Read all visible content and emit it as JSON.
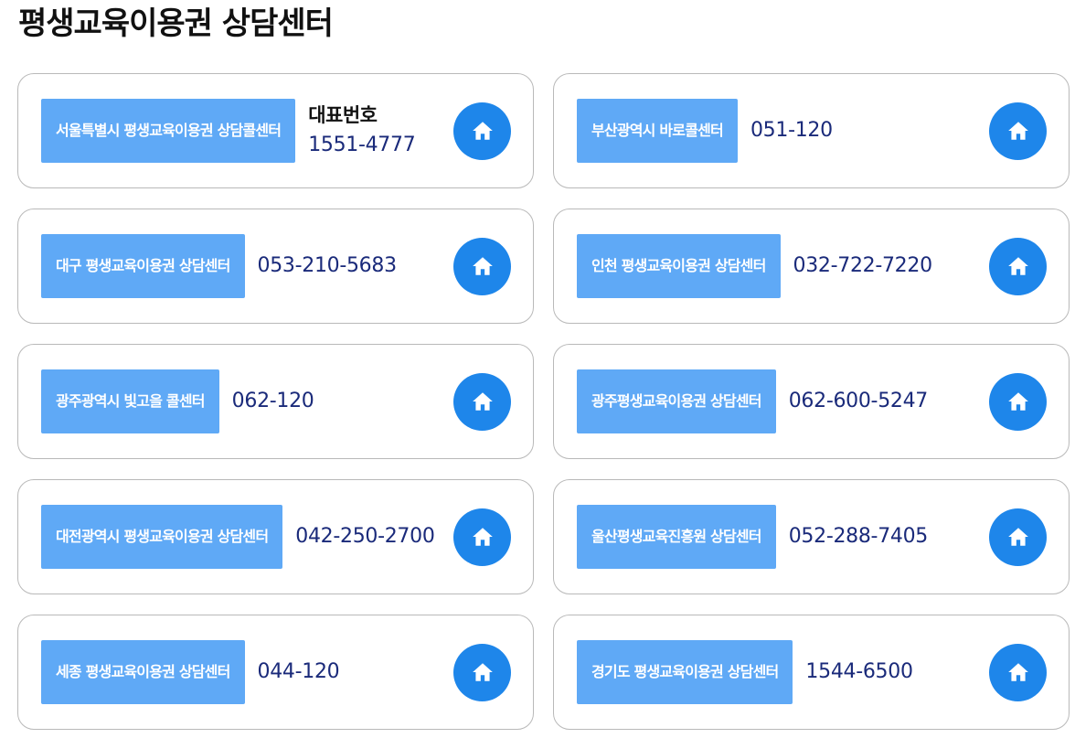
{
  "page": {
    "title": "평생교육이용권 상담센터"
  },
  "colors": {
    "name_badge": "#5fa9f6",
    "home_button": "#1e86ea",
    "phone_text": "#1a2a7a",
    "card_border": "#b9b9b9"
  },
  "icons": {
    "home": "home-icon"
  },
  "centers": [
    {
      "name": "서울특별시 평생교육이용권 상담콜센터",
      "label": "대표번호",
      "phone": "1551-4777"
    },
    {
      "name": "부산광역시 바로콜센터",
      "label": "",
      "phone": "051-120"
    },
    {
      "name": "대구 평생교육이용권 상담센터",
      "label": "",
      "phone": "053-210-5683"
    },
    {
      "name": "인천 평생교육이용권 상담센터",
      "label": "",
      "phone": "032-722-7220"
    },
    {
      "name": "광주광역시 빛고을 콜센터",
      "label": "",
      "phone": "062-120"
    },
    {
      "name": "광주평생교육이용권 상담센터",
      "label": "",
      "phone": "062-600-5247"
    },
    {
      "name": "대전광역시 평생교육이용권 상담센터",
      "label": "",
      "phone": "042-250-2700"
    },
    {
      "name": "울산평생교육진흥원 상담센터",
      "label": "",
      "phone": "052-288-7405"
    },
    {
      "name": "세종 평생교육이용권 상담센터",
      "label": "",
      "phone": "044-120"
    },
    {
      "name": "경기도 평생교육이용권 상담센터",
      "label": "",
      "phone": "1544-6500"
    }
  ]
}
